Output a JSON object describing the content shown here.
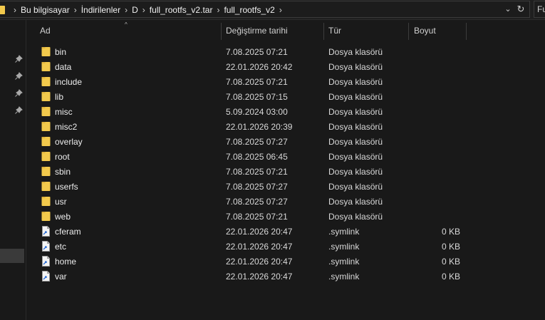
{
  "address_bar": {
    "crumbs": [
      "Bu bilgisayar",
      "İndirilenler",
      "D",
      "full_rootfs_v2.tar",
      "full_rootfs_v2"
    ],
    "dropdown_glyph": "⌄",
    "refresh_glyph": "↻"
  },
  "search": {
    "visible_text": "Fu"
  },
  "columns": {
    "name": "Ad",
    "modified": "Değiştirme tarihi",
    "type": "Tür",
    "size": "Boyut",
    "sort_glyph": "^"
  },
  "files": [
    {
      "name": "bin",
      "modified": "7.08.2025 07:21",
      "type": "Dosya klasörü",
      "size": "",
      "icon": "folder-icon"
    },
    {
      "name": "data",
      "modified": "22.01.2026 20:42",
      "type": "Dosya klasörü",
      "size": "",
      "icon": "folder-icon"
    },
    {
      "name": "include",
      "modified": "7.08.2025 07:21",
      "type": "Dosya klasörü",
      "size": "",
      "icon": "folder-icon"
    },
    {
      "name": "lib",
      "modified": "7.08.2025 07:15",
      "type": "Dosya klasörü",
      "size": "",
      "icon": "folder-icon"
    },
    {
      "name": "misc",
      "modified": "5.09.2024 03:00",
      "type": "Dosya klasörü",
      "size": "",
      "icon": "folder-icon"
    },
    {
      "name": "misc2",
      "modified": "22.01.2026 20:39",
      "type": "Dosya klasörü",
      "size": "",
      "icon": "folder-icon"
    },
    {
      "name": "overlay",
      "modified": "7.08.2025 07:27",
      "type": "Dosya klasörü",
      "size": "",
      "icon": "folder-icon"
    },
    {
      "name": "root",
      "modified": "7.08.2025 06:45",
      "type": "Dosya klasörü",
      "size": "",
      "icon": "folder-icon"
    },
    {
      "name": "sbin",
      "modified": "7.08.2025 07:21",
      "type": "Dosya klasörü",
      "size": "",
      "icon": "folder-icon"
    },
    {
      "name": "userfs",
      "modified": "7.08.2025 07:27",
      "type": "Dosya klasörü",
      "size": "",
      "icon": "folder-icon"
    },
    {
      "name": "usr",
      "modified": "7.08.2025 07:27",
      "type": "Dosya klasörü",
      "size": "",
      "icon": "folder-icon"
    },
    {
      "name": "web",
      "modified": "7.08.2025 07:21",
      "type": "Dosya klasörü",
      "size": "",
      "icon": "folder-icon"
    },
    {
      "name": "cferam",
      "modified": "22.01.2026 20:47",
      "type": ".symlink",
      "size": "0 KB",
      "icon": "file-icon"
    },
    {
      "name": "etc",
      "modified": "22.01.2026 20:47",
      "type": ".symlink",
      "size": "0 KB",
      "icon": "file-icon"
    },
    {
      "name": "home",
      "modified": "22.01.2026 20:47",
      "type": ".symlink",
      "size": "0 KB",
      "icon": "file-icon"
    },
    {
      "name": "var",
      "modified": "22.01.2026 20:47",
      "type": ".symlink",
      "size": "0 KB",
      "icon": "file-icon"
    }
  ],
  "colors": {
    "background": "#191919",
    "folder": "#f2c94c",
    "text": "#e6e6e6"
  }
}
